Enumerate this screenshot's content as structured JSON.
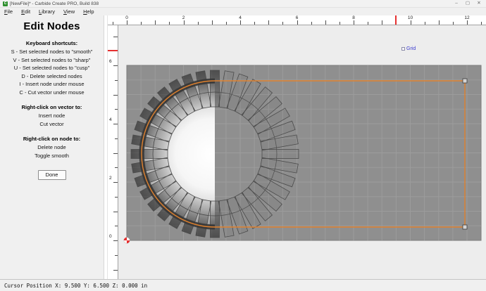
{
  "window": {
    "title": "[NewFile]* - Carbide Create PRO, Build 838",
    "app_icon_letter": "C",
    "minimize_glyph": "–",
    "maximize_glyph": "▢",
    "close_glyph": "✕"
  },
  "menu": {
    "items": [
      {
        "label": "File"
      },
      {
        "label": "Edit"
      },
      {
        "label": "Library"
      },
      {
        "label": "View"
      },
      {
        "label": "Help"
      }
    ]
  },
  "panel": {
    "title": "Edit Nodes",
    "sections": [
      {
        "heading": "Keyboard shortcuts:",
        "lines": [
          "S - Set selected nodes to \"smooth\"",
          "V - Set selected nodes to \"sharp\"",
          "U - Set selected nodes to \"cusp\"",
          "D - Delete selected nodes",
          "I - Insert node under mouse",
          "C - Cut vector under mouse"
        ]
      },
      {
        "heading": "Right-click on vector to:",
        "lines": [
          "Insert node",
          "Cut vector"
        ]
      },
      {
        "heading": "Right-click on node to:",
        "lines": [
          "Delete node",
          "Toggle smooth"
        ]
      }
    ],
    "done_label": "Done"
  },
  "canvas": {
    "grid_label": "Grid",
    "ruler_h_labels": [
      "0",
      "2",
      "4",
      "6",
      "8",
      "10",
      "12"
    ],
    "ruler_v_labels": [
      "0",
      "2",
      "4",
      "6"
    ],
    "cursor": {
      "x_in": 9.5,
      "y_in": 6.5
    }
  },
  "status": {
    "text": "Cursor Position X: 9.500 Y: 6.500 Z: 0.000 in"
  },
  "colors": {
    "accent_orange": "#e0812d",
    "stock_gray": "#8f8f8f",
    "grid_line_gray": "#9c9c9c",
    "marker_red": "#e63030",
    "grid_link_blue": "#3a3ad0",
    "vector_dark": "#353535"
  }
}
